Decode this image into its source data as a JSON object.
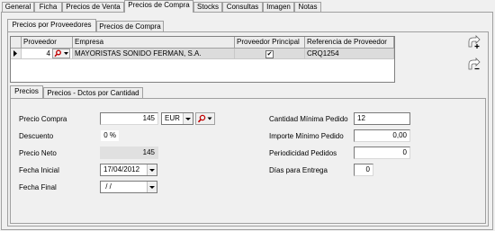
{
  "top_tabs": [
    "General",
    "Ficha",
    "Precios de Venta",
    "Precios de Compra",
    "Stocks",
    "Consultas",
    "Imagen",
    "Notas"
  ],
  "top_tabs_active": "Precios de Compra",
  "sub_tabs": [
    "Precios por Proveedores",
    "Precios de Compra"
  ],
  "grid": {
    "headers": [
      "Proveedor",
      "Empresa",
      "Proveedor Principal",
      "Referencia de Proveedor"
    ],
    "rows": [
      {
        "proveedor": "4",
        "empresa": "MAYORISTAS SONIDO FERMAN, S.A.",
        "principal_mark": "✔",
        "referencia": "CRQ1254"
      }
    ]
  },
  "detail_tabs": [
    "Precios",
    "Precios - Dctos por Cantidad"
  ],
  "form": {
    "precio_compra_label": "Precio Compra",
    "precio_compra_value": "145",
    "currency_value": "EUR",
    "descuento_label": "Descuento",
    "descuento_value": "0 %",
    "precio_neto_label": "Precio Neto",
    "precio_neto_value": "145",
    "fecha_inicial_label": "Fecha Inicial",
    "fecha_inicial_value": "17/04/2012",
    "fecha_final_label": "Fecha Final",
    "fecha_final_value": " / /",
    "cantidad_minima_label": "Cantidad Mínima Pedido",
    "cantidad_minima_value": "12",
    "importe_minimo_label": "Importe Mínimo Pedido",
    "importe_minimo_value": "0,00",
    "periodicidad_label": "Periodicidad Pedidos",
    "periodicidad_value": "0",
    "dias_entrega_label": "Días para Entrega",
    "dias_entrega_value": "0"
  },
  "icons": {
    "row_pointer": "row-pointer-icon",
    "search": "magnifier-icon",
    "add": "add-record-icon",
    "delete": "delete-record-icon"
  },
  "colors": {
    "lens_red": "#c00000",
    "selected_row_gray": "#dcdcdc"
  }
}
